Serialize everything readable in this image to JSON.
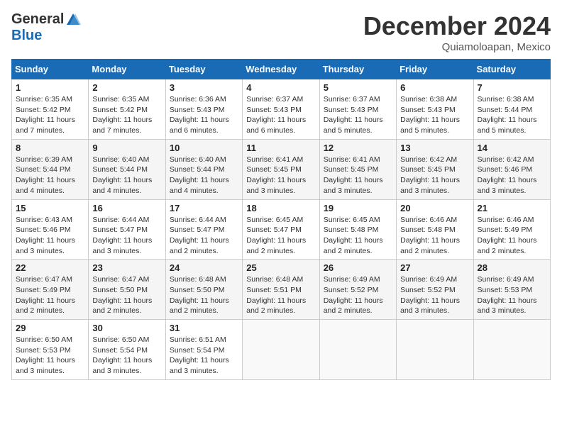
{
  "logo": {
    "general": "General",
    "blue": "Blue"
  },
  "title": {
    "month": "December 2024",
    "location": "Quiamoloapan, Mexico"
  },
  "weekdays": [
    "Sunday",
    "Monday",
    "Tuesday",
    "Wednesday",
    "Thursday",
    "Friday",
    "Saturday"
  ],
  "weeks": [
    [
      {
        "day": "1",
        "sunrise": "6:35 AM",
        "sunset": "5:42 PM",
        "daylight": "11 hours and 7 minutes."
      },
      {
        "day": "2",
        "sunrise": "6:35 AM",
        "sunset": "5:42 PM",
        "daylight": "11 hours and 7 minutes."
      },
      {
        "day": "3",
        "sunrise": "6:36 AM",
        "sunset": "5:43 PM",
        "daylight": "11 hours and 6 minutes."
      },
      {
        "day": "4",
        "sunrise": "6:37 AM",
        "sunset": "5:43 PM",
        "daylight": "11 hours and 6 minutes."
      },
      {
        "day": "5",
        "sunrise": "6:37 AM",
        "sunset": "5:43 PM",
        "daylight": "11 hours and 5 minutes."
      },
      {
        "day": "6",
        "sunrise": "6:38 AM",
        "sunset": "5:43 PM",
        "daylight": "11 hours and 5 minutes."
      },
      {
        "day": "7",
        "sunrise": "6:38 AM",
        "sunset": "5:44 PM",
        "daylight": "11 hours and 5 minutes."
      }
    ],
    [
      {
        "day": "8",
        "sunrise": "6:39 AM",
        "sunset": "5:44 PM",
        "daylight": "11 hours and 4 minutes."
      },
      {
        "day": "9",
        "sunrise": "6:40 AM",
        "sunset": "5:44 PM",
        "daylight": "11 hours and 4 minutes."
      },
      {
        "day": "10",
        "sunrise": "6:40 AM",
        "sunset": "5:44 PM",
        "daylight": "11 hours and 4 minutes."
      },
      {
        "day": "11",
        "sunrise": "6:41 AM",
        "sunset": "5:45 PM",
        "daylight": "11 hours and 3 minutes."
      },
      {
        "day": "12",
        "sunrise": "6:41 AM",
        "sunset": "5:45 PM",
        "daylight": "11 hours and 3 minutes."
      },
      {
        "day": "13",
        "sunrise": "6:42 AM",
        "sunset": "5:45 PM",
        "daylight": "11 hours and 3 minutes."
      },
      {
        "day": "14",
        "sunrise": "6:42 AM",
        "sunset": "5:46 PM",
        "daylight": "11 hours and 3 minutes."
      }
    ],
    [
      {
        "day": "15",
        "sunrise": "6:43 AM",
        "sunset": "5:46 PM",
        "daylight": "11 hours and 3 minutes."
      },
      {
        "day": "16",
        "sunrise": "6:44 AM",
        "sunset": "5:47 PM",
        "daylight": "11 hours and 3 minutes."
      },
      {
        "day": "17",
        "sunrise": "6:44 AM",
        "sunset": "5:47 PM",
        "daylight": "11 hours and 2 minutes."
      },
      {
        "day": "18",
        "sunrise": "6:45 AM",
        "sunset": "5:47 PM",
        "daylight": "11 hours and 2 minutes."
      },
      {
        "day": "19",
        "sunrise": "6:45 AM",
        "sunset": "5:48 PM",
        "daylight": "11 hours and 2 minutes."
      },
      {
        "day": "20",
        "sunrise": "6:46 AM",
        "sunset": "5:48 PM",
        "daylight": "11 hours and 2 minutes."
      },
      {
        "day": "21",
        "sunrise": "6:46 AM",
        "sunset": "5:49 PM",
        "daylight": "11 hours and 2 minutes."
      }
    ],
    [
      {
        "day": "22",
        "sunrise": "6:47 AM",
        "sunset": "5:49 PM",
        "daylight": "11 hours and 2 minutes."
      },
      {
        "day": "23",
        "sunrise": "6:47 AM",
        "sunset": "5:50 PM",
        "daylight": "11 hours and 2 minutes."
      },
      {
        "day": "24",
        "sunrise": "6:48 AM",
        "sunset": "5:50 PM",
        "daylight": "11 hours and 2 minutes."
      },
      {
        "day": "25",
        "sunrise": "6:48 AM",
        "sunset": "5:51 PM",
        "daylight": "11 hours and 2 minutes."
      },
      {
        "day": "26",
        "sunrise": "6:49 AM",
        "sunset": "5:52 PM",
        "daylight": "11 hours and 2 minutes."
      },
      {
        "day": "27",
        "sunrise": "6:49 AM",
        "sunset": "5:52 PM",
        "daylight": "11 hours and 3 minutes."
      },
      {
        "day": "28",
        "sunrise": "6:49 AM",
        "sunset": "5:53 PM",
        "daylight": "11 hours and 3 minutes."
      }
    ],
    [
      {
        "day": "29",
        "sunrise": "6:50 AM",
        "sunset": "5:53 PM",
        "daylight": "11 hours and 3 minutes."
      },
      {
        "day": "30",
        "sunrise": "6:50 AM",
        "sunset": "5:54 PM",
        "daylight": "11 hours and 3 minutes."
      },
      {
        "day": "31",
        "sunrise": "6:51 AM",
        "sunset": "5:54 PM",
        "daylight": "11 hours and 3 minutes."
      },
      null,
      null,
      null,
      null
    ]
  ],
  "labels": {
    "sunrise": "Sunrise:",
    "sunset": "Sunset:",
    "daylight": "Daylight:"
  }
}
